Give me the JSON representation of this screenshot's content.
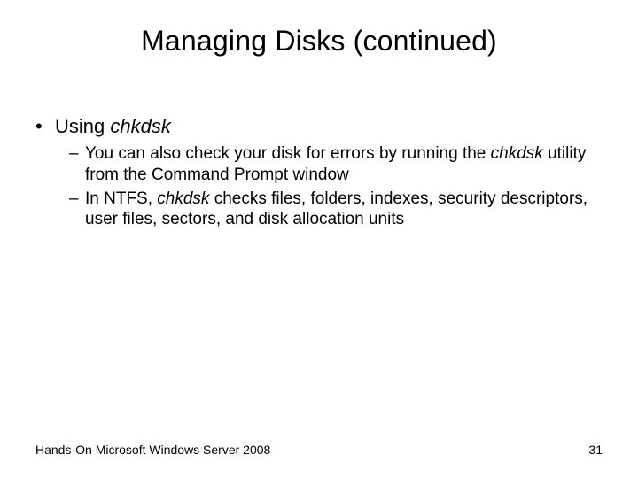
{
  "title": "Managing Disks (continued)",
  "bullet": {
    "label_part1": "Using ",
    "label_italic": "chkdsk",
    "sub": [
      {
        "prefix": "You can also check your disk for errors by running the ",
        "italic": "chkdsk",
        "suffix": " utility from the Command Prompt window"
      },
      {
        "prefix": "In NTFS, ",
        "italic": "chkdsk",
        "suffix": " checks files, folders, indexes, security descriptors, user files, sectors, and disk allocation units"
      }
    ]
  },
  "footer": {
    "left": "Hands-On Microsoft Windows Server 2008",
    "right": "31"
  }
}
